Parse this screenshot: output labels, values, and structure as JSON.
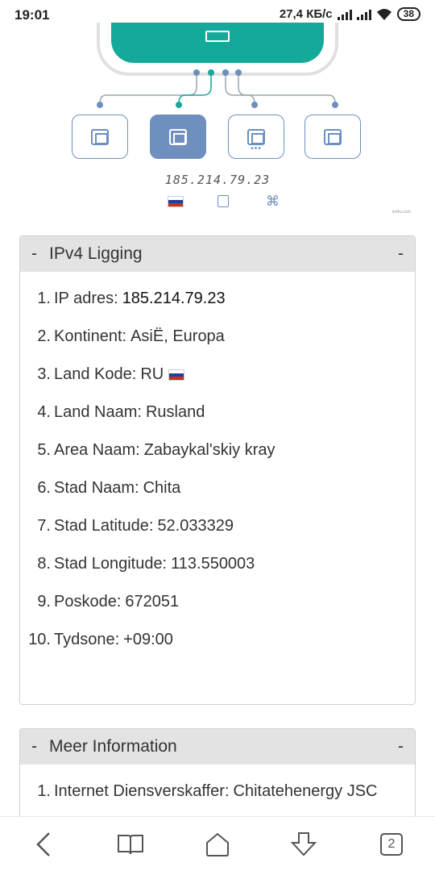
{
  "status_bar": {
    "time": "19:01",
    "network_speed": "27,4 КБ/с",
    "battery": "38"
  },
  "hero": {
    "ip_caption": "185.214.79.23",
    "credit": "ipdhu.com",
    "accent_color": "#14a99a",
    "port_color": "#6b8fbf"
  },
  "ipv4_panel": {
    "title": "IPv4 Ligging",
    "dash": "-",
    "collapse": "-",
    "items": [
      {
        "num": "1.",
        "label": "IP adres:",
        "value": "185.214.79.23"
      },
      {
        "num": "2.",
        "label": "Kontinent:",
        "value": "AsiË, Europa"
      },
      {
        "num": "3.",
        "label": "Land Kode:",
        "value": "RU"
      },
      {
        "num": "4.",
        "label": "Land Naam:",
        "value": "Rusland"
      },
      {
        "num": "5.",
        "label": "Area Naam:",
        "value": "Zabaykal'skiy kray"
      },
      {
        "num": "6.",
        "label": "Stad Naam:",
        "value": "Chita"
      },
      {
        "num": "7.",
        "label": "Stad Latitude:",
        "value": "52.033329"
      },
      {
        "num": "8.",
        "label": "Stad Longitude:",
        "value": "113.550003"
      },
      {
        "num": "9.",
        "label": "Poskode:",
        "value": "672051"
      },
      {
        "num": "10.",
        "label": "Tydsone:",
        "value": "+09:00"
      }
    ]
  },
  "more_panel": {
    "title": "Meer Information",
    "dash": "-",
    "collapse": "-",
    "items": [
      {
        "num": "1.",
        "label": "Internet Diensverskaffer:",
        "value": "Chitatehenergy JSC"
      }
    ]
  },
  "nav": {
    "tab_count": "2"
  }
}
